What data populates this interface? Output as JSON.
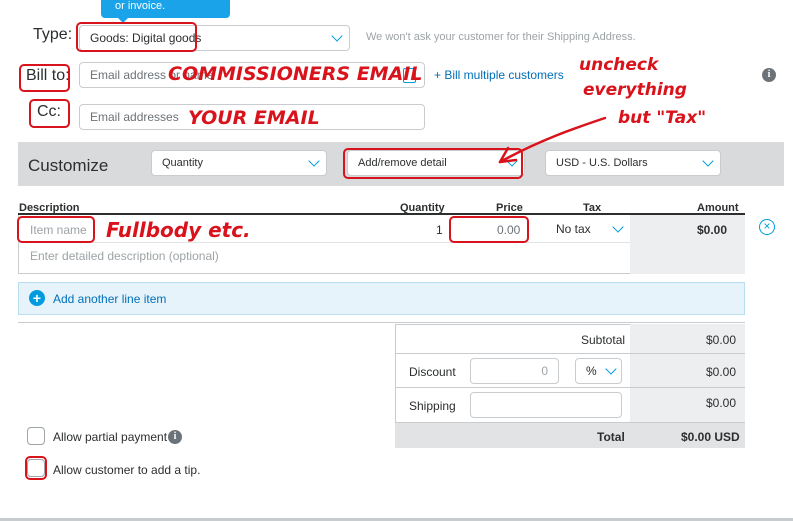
{
  "tooltip": {
    "text": "or invoice."
  },
  "type_row": {
    "label": "Type:",
    "value": "Goods: Digital goods",
    "hint": "We won't ask your customer for their Shipping Address."
  },
  "bill_row": {
    "label": "Bill to:",
    "placeholder": "Email address or name",
    "multi_link": "+ Bill multiple customers"
  },
  "cc_row": {
    "label": "Cc:",
    "placeholder": "Email addresses"
  },
  "customize": {
    "title": "Customize",
    "quantity_select": "Quantity",
    "detail_select": "Add/remove detail",
    "currency_select": "USD - U.S. Dollars"
  },
  "columns": {
    "description": "Description",
    "quantity": "Quantity",
    "price": "Price",
    "tax": "Tax",
    "amount": "Amount"
  },
  "line_item": {
    "name_placeholder": "Item name",
    "quantity": "1",
    "price": "0.00",
    "tax": "No tax",
    "amount": "$0.00",
    "description_placeholder": "Enter detailed description (optional)"
  },
  "add_line": {
    "label": "Add another line item"
  },
  "summary": {
    "subtotal_label": "Subtotal",
    "subtotal_value": "$0.00",
    "discount_label": "Discount",
    "discount_input": "0",
    "discount_unit": "%",
    "discount_value": "$0.00",
    "shipping_label": "Shipping",
    "shipping_value": "$0.00",
    "total_label": "Total",
    "total_value": "$0.00 USD"
  },
  "options": {
    "partial_payment": "Allow partial payment",
    "tip": "Allow customer to add a tip."
  },
  "annotations": {
    "commissioner": "COMMISSIONERS EMAIL",
    "your_email": "YOUR EMAIL",
    "uncheck_1": "uncheck",
    "uncheck_2": "everything",
    "uncheck_3": "but \"Tax\"",
    "fullbody": "Fullbody etc."
  },
  "colors": {
    "accent": "#009cde",
    "link": "#0070ba",
    "annotation_red": "#d8131c",
    "customize_bar": "#d9dadb",
    "tooltip": "#1aa3e8"
  }
}
